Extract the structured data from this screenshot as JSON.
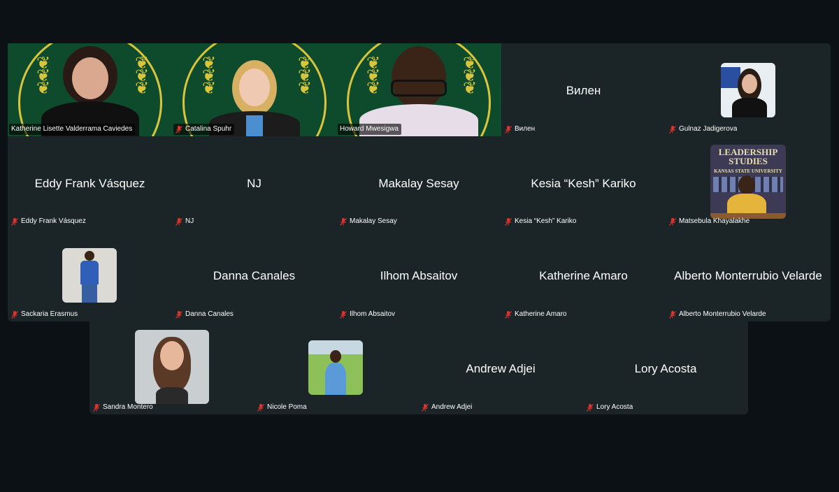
{
  "meeting": {
    "participants": [
      {
        "id": "p1",
        "name": "Katherine Lisette Valderrama Caviedes",
        "muted": false,
        "video": true
      },
      {
        "id": "p2",
        "name": "Catalina Spuhr",
        "muted": true,
        "video": true
      },
      {
        "id": "p3",
        "name": "Howard Mwesigwa",
        "muted": false,
        "video": true,
        "active_speaker": true
      },
      {
        "id": "p4",
        "name": "Вилен",
        "display": "Вилен",
        "muted": true,
        "video": false
      },
      {
        "id": "p5",
        "name": "Gulnaz Jadigerova",
        "muted": true,
        "video": false,
        "avatar": "photo"
      },
      {
        "id": "p6",
        "name": "Eddy Frank Vásquez",
        "display": "Eddy Frank Vásquez",
        "muted": true,
        "video": false
      },
      {
        "id": "p7",
        "name": "NJ",
        "display": "NJ",
        "muted": true,
        "video": false
      },
      {
        "id": "p8",
        "name": "Makalay Sesay",
        "display": "Makalay Sesay",
        "muted": true,
        "video": false
      },
      {
        "id": "p9",
        "name": "Kesia “Kesh” Kariko",
        "display": "Kesia “Kesh” Kariko",
        "muted": true,
        "video": false
      },
      {
        "id": "p10",
        "name": "Matsebula Khayalakhe",
        "muted": true,
        "video": false,
        "avatar": "photo",
        "avatar_text": "LEADERSHIP STUDIES",
        "avatar_subtext": "KANSAS STATE UNIVERSITY"
      },
      {
        "id": "p11",
        "name": "Sackaria Erasmus",
        "muted": true,
        "video": false,
        "avatar": "photo"
      },
      {
        "id": "p12",
        "name": "Danna Canales",
        "display": "Danna Canales",
        "muted": true,
        "video": false
      },
      {
        "id": "p13",
        "name": "Ilhom Absaitov",
        "display": "Ilhom Absaitov",
        "muted": true,
        "video": false
      },
      {
        "id": "p14",
        "name": "Katherine Amaro",
        "display": "Katherine Amaro",
        "muted": true,
        "video": false
      },
      {
        "id": "p15",
        "name": "Alberto Monterrubio Velarde",
        "display": "Alberto Monterrubio Velarde",
        "muted": true,
        "video": false
      },
      {
        "id": "p16",
        "name": "Sandra Montero",
        "muted": true,
        "video": false,
        "avatar": "photo"
      },
      {
        "id": "p17",
        "name": "Nicole Poma",
        "muted": true,
        "video": false,
        "avatar": "photo"
      },
      {
        "id": "p18",
        "name": "Andrew Adjei",
        "display": "Andrew Adjei",
        "muted": true,
        "video": false
      },
      {
        "id": "p19",
        "name": "Lory Acosta",
        "display": "Lory Acosta",
        "muted": true,
        "video": false
      }
    ]
  },
  "icons": {
    "muted": "microphone-muted-icon"
  },
  "colors": {
    "background": "#0b1114",
    "tile": "#1b2528",
    "active_speaker_border": "#5fd06d",
    "mute_red": "#e0332e",
    "video_green": "#0e4a2c",
    "emblem_gold": "#d8c53d"
  }
}
